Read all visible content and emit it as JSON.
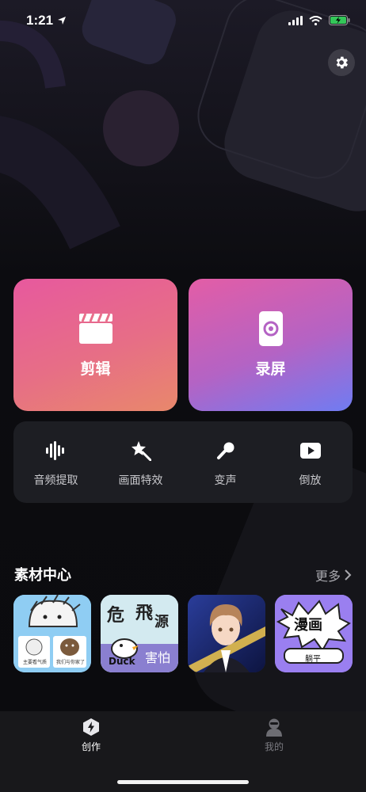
{
  "status": {
    "time": "1:21"
  },
  "cards": {
    "edit_label": "剪辑",
    "record_label": "录屏"
  },
  "tools": [
    {
      "label": "音频提取",
      "icon": "audio-wave-icon"
    },
    {
      "label": "画面特效",
      "icon": "magic-star-icon"
    },
    {
      "label": "变声",
      "icon": "microphone-icon"
    },
    {
      "label": "倒放",
      "icon": "play-reverse-icon"
    }
  ],
  "materials": {
    "title": "素材中心",
    "more_label": "更多",
    "items": [
      {
        "name": "sticker-hedgehog",
        "text_a": "主要看气质",
        "text_b": "我们与你家了"
      },
      {
        "name": "sticker-duck-text",
        "text_a": "危",
        "text_b": "害怕"
      },
      {
        "name": "anime-boy"
      },
      {
        "name": "comic-frame",
        "text_a": "漫画",
        "text_b": "躺平"
      }
    ]
  },
  "tabbar": {
    "create_label": "创作",
    "mine_label": "我的"
  },
  "colors": {
    "accent_pink": "#e7599e",
    "accent_blue": "#6f7cf2",
    "panel": "#1d1e23"
  }
}
